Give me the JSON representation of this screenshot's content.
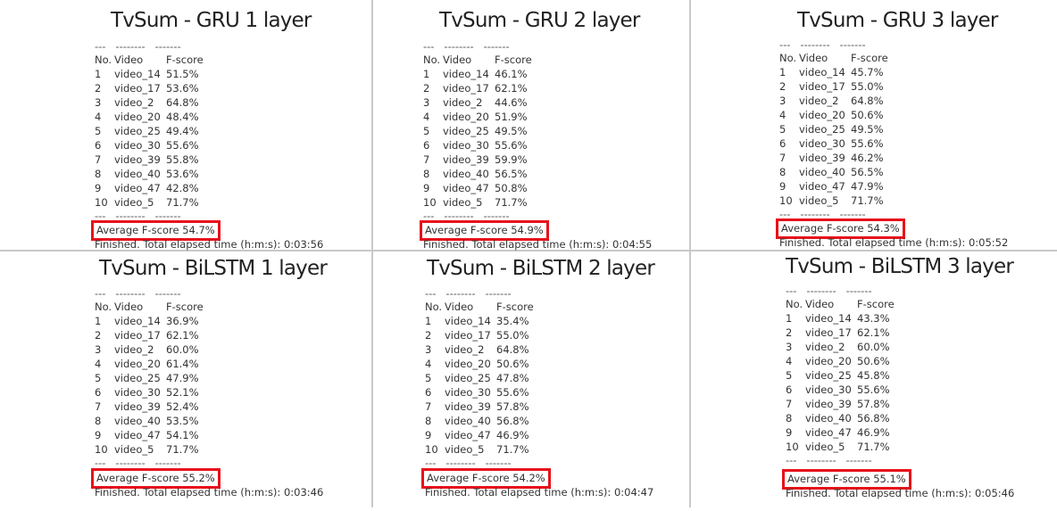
{
  "panels": [
    {
      "title": "TvSum - GRU 1 layer",
      "dashes": "---   --------   -------",
      "header": {
        "no": "No.",
        "video": "Video",
        "score": "F-score"
      },
      "rows": [
        {
          "no": "1",
          "video": "video_14",
          "score": "51.5%"
        },
        {
          "no": "2",
          "video": "video_17",
          "score": "53.6%"
        },
        {
          "no": "3",
          "video": "video_2",
          "score": "64.8%"
        },
        {
          "no": "4",
          "video": "video_20",
          "score": "48.4%"
        },
        {
          "no": "5",
          "video": "video_25",
          "score": "49.4%"
        },
        {
          "no": "6",
          "video": "video_30",
          "score": "55.6%"
        },
        {
          "no": "7",
          "video": "video_39",
          "score": "55.8%"
        },
        {
          "no": "8",
          "video": "video_40",
          "score": "53.6%"
        },
        {
          "no": "9",
          "video": "video_47",
          "score": "42.8%"
        },
        {
          "no": "10",
          "video": "video_5",
          "score": "71.7%"
        }
      ],
      "average": "Average F-score 54.7%",
      "finished": "Finished. Total elapsed time (h:m:s): 0:03:56"
    },
    {
      "title": "TvSum - GRU 2 layer",
      "dashes": "---   --------   -------",
      "header": {
        "no": "No.",
        "video": "Video",
        "score": "F-score"
      },
      "rows": [
        {
          "no": "1",
          "video": "video_14",
          "score": "46.1%"
        },
        {
          "no": "2",
          "video": "video_17",
          "score": "62.1%"
        },
        {
          "no": "3",
          "video": "video_2",
          "score": "44.6%"
        },
        {
          "no": "4",
          "video": "video_20",
          "score": "51.9%"
        },
        {
          "no": "5",
          "video": "video_25",
          "score": "49.5%"
        },
        {
          "no": "6",
          "video": "video_30",
          "score": "55.6%"
        },
        {
          "no": "7",
          "video": "video_39",
          "score": "59.9%"
        },
        {
          "no": "8",
          "video": "video_40",
          "score": "56.5%"
        },
        {
          "no": "9",
          "video": "video_47",
          "score": "50.8%"
        },
        {
          "no": "10",
          "video": "video_5",
          "score": "71.7%"
        }
      ],
      "average": "Average F-score 54.9%",
      "finished": "Finished. Total elapsed time (h:m:s): 0:04:55"
    },
    {
      "title": "TvSum - GRU 3 layer",
      "dashes": "---   --------   -------",
      "header": {
        "no": "No.",
        "video": "Video",
        "score": "F-score"
      },
      "rows": [
        {
          "no": "1",
          "video": "video_14",
          "score": "45.7%"
        },
        {
          "no": "2",
          "video": "video_17",
          "score": "55.0%"
        },
        {
          "no": "3",
          "video": "video_2",
          "score": "64.8%"
        },
        {
          "no": "4",
          "video": "video_20",
          "score": "50.6%"
        },
        {
          "no": "5",
          "video": "video_25",
          "score": "49.5%"
        },
        {
          "no": "6",
          "video": "video_30",
          "score": "55.6%"
        },
        {
          "no": "7",
          "video": "video_39",
          "score": "46.2%"
        },
        {
          "no": "8",
          "video": "video_40",
          "score": "56.5%"
        },
        {
          "no": "9",
          "video": "video_47",
          "score": "47.9%"
        },
        {
          "no": "10",
          "video": "video_5",
          "score": "71.7%"
        }
      ],
      "average": "Average F-score 54.3%",
      "finished": "Finished. Total elapsed time (h:m:s): 0:05:52"
    },
    {
      "title": "TvSum - BiLSTM 1 layer",
      "dashes": "---   --------   -------",
      "header": {
        "no": "No.",
        "video": "Video",
        "score": "F-score"
      },
      "rows": [
        {
          "no": "1",
          "video": "video_14",
          "score": "36.9%"
        },
        {
          "no": "2",
          "video": "video_17",
          "score": "62.1%"
        },
        {
          "no": "3",
          "video": "video_2",
          "score": "60.0%"
        },
        {
          "no": "4",
          "video": "video_20",
          "score": "61.4%"
        },
        {
          "no": "5",
          "video": "video_25",
          "score": "47.9%"
        },
        {
          "no": "6",
          "video": "video_30",
          "score": "52.1%"
        },
        {
          "no": "7",
          "video": "video_39",
          "score": "52.4%"
        },
        {
          "no": "8",
          "video": "video_40",
          "score": "53.5%"
        },
        {
          "no": "9",
          "video": "video_47",
          "score": "54.1%"
        },
        {
          "no": "10",
          "video": "video_5",
          "score": "71.7%"
        }
      ],
      "average": "Average F-score 55.2%",
      "finished": "Finished. Total elapsed time (h:m:s): 0:03:46"
    },
    {
      "title": "TvSum - BiLSTM 2 layer",
      "dashes": "---   --------   -------",
      "header": {
        "no": "No.",
        "video": "Video",
        "score": "F-score"
      },
      "rows": [
        {
          "no": "1",
          "video": "video_14",
          "score": "35.4%"
        },
        {
          "no": "2",
          "video": "video_17",
          "score": "55.0%"
        },
        {
          "no": "3",
          "video": "video_2",
          "score": "64.8%"
        },
        {
          "no": "4",
          "video": "video_20",
          "score": "50.6%"
        },
        {
          "no": "5",
          "video": "video_25",
          "score": "47.8%"
        },
        {
          "no": "6",
          "video": "video_30",
          "score": "55.6%"
        },
        {
          "no": "7",
          "video": "video_39",
          "score": "57.8%"
        },
        {
          "no": "8",
          "video": "video_40",
          "score": "56.8%"
        },
        {
          "no": "9",
          "video": "video_47",
          "score": "46.9%"
        },
        {
          "no": "10",
          "video": "video_5",
          "score": "71.7%"
        }
      ],
      "average": "Average F-score 54.2%",
      "finished": "Finished. Total elapsed time (h:m:s): 0:04:47"
    },
    {
      "title": "TvSum - BiLSTM 3 layer",
      "dashes": "---   --------   -------",
      "header": {
        "no": "No.",
        "video": "Video",
        "score": "F-score"
      },
      "rows": [
        {
          "no": "1",
          "video": "video_14",
          "score": "43.3%"
        },
        {
          "no": "2",
          "video": "video_17",
          "score": "62.1%"
        },
        {
          "no": "3",
          "video": "video_2",
          "score": "60.0%"
        },
        {
          "no": "4",
          "video": "video_20",
          "score": "50.6%"
        },
        {
          "no": "5",
          "video": "video_25",
          "score": "45.8%"
        },
        {
          "no": "6",
          "video": "video_30",
          "score": "55.6%"
        },
        {
          "no": "7",
          "video": "video_39",
          "score": "57.8%"
        },
        {
          "no": "8",
          "video": "video_40",
          "score": "56.8%"
        },
        {
          "no": "9",
          "video": "video_47",
          "score": "46.9%"
        },
        {
          "no": "10",
          "video": "video_5",
          "score": "71.7%"
        }
      ],
      "average": "Average F-score 55.1%",
      "finished": "Finished. Total elapsed time (h:m:s): 0:05:46"
    }
  ]
}
